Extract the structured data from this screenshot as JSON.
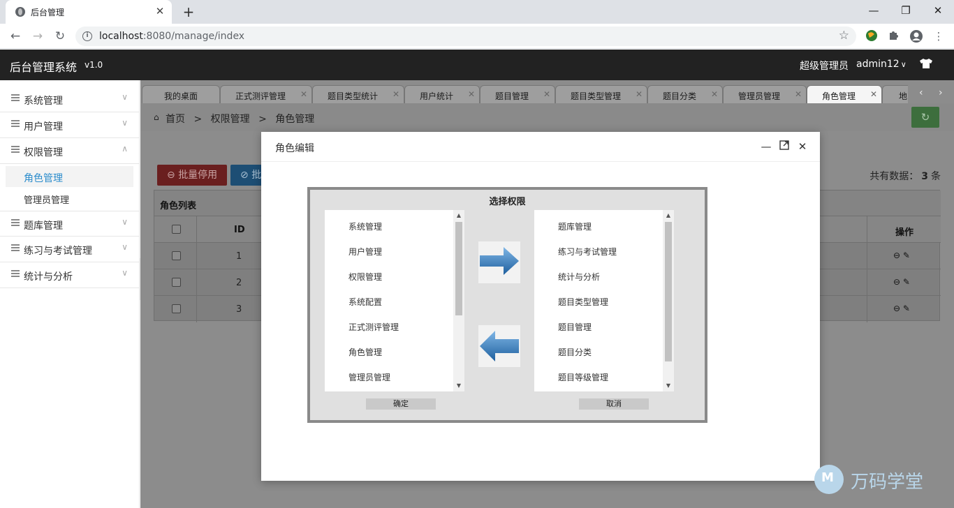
{
  "browser": {
    "tab_title": "后台管理",
    "tab_close": "✕",
    "new_tab": "+",
    "url_host": "localhost",
    "url_rest": ":8080/manage/index",
    "win_min": "—",
    "win_restore": "❐",
    "win_close": "✕"
  },
  "header": {
    "brand": "后台管理系统",
    "version": "v1.0",
    "role": "超级管理员",
    "username": "admin12"
  },
  "sidebar": {
    "items": [
      {
        "label": "系统管理"
      },
      {
        "label": "用户管理"
      },
      {
        "label": "权限管理",
        "expanded": true,
        "children": [
          {
            "label": "角色管理",
            "active": true
          },
          {
            "label": "管理员管理"
          }
        ]
      },
      {
        "label": "题库管理"
      },
      {
        "label": "练习与考试管理"
      },
      {
        "label": "统计与分析"
      }
    ]
  },
  "tabs": [
    {
      "label": "我的桌面"
    },
    {
      "label": "正式测评管理"
    },
    {
      "label": "题目类型统计"
    },
    {
      "label": "用户统计"
    },
    {
      "label": "题目管理"
    },
    {
      "label": "题目类型管理"
    },
    {
      "label": "题目分类"
    },
    {
      "label": "管理员管理"
    },
    {
      "label": "角色管理",
      "active": true
    },
    {
      "label": "地"
    }
  ],
  "breadcrumb": {
    "home": "首页",
    "level1": "权限管理",
    "level2": "角色管理",
    "sep": ">"
  },
  "toolbar": {
    "batch_disable": "批量停用",
    "batch_enable": "批",
    "total_label": "共有数据：",
    "total_count": "3",
    "total_unit": "条"
  },
  "table": {
    "caption": "角色列表",
    "headers": {
      "id": "ID",
      "ops": "操作"
    },
    "rows": [
      {
        "id": "1"
      },
      {
        "id": "2"
      },
      {
        "id": "3"
      }
    ]
  },
  "modal": {
    "title": "角色编辑",
    "panel_title": "选择权限",
    "left_list": [
      "系统管理",
      "用户管理",
      "权限管理",
      "系统配置",
      "正式测评管理",
      "角色管理",
      "管理员管理"
    ],
    "right_list": [
      "题库管理",
      "练习与考试管理",
      "统计与分析",
      "题目类型管理",
      "题目管理",
      "题目分类",
      "题目等级管理"
    ],
    "confirm": "确定",
    "cancel": "取消"
  },
  "watermark": {
    "text": "万码学堂"
  },
  "colors": {
    "header_bg": "#222222",
    "active_link": "#2b8ccc",
    "arrow_blue": "#2d7bc4"
  }
}
